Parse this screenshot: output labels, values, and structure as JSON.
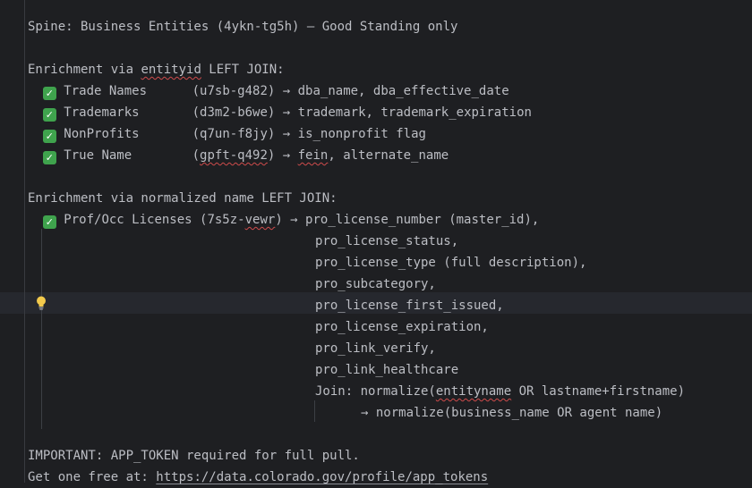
{
  "title_line": "Spine: Business Entities (4ykn-tg5h) — Good Standing only",
  "entityid_section": {
    "prefix": "Enrichment via ",
    "keyword": "entityid",
    "suffix": " LEFT JOIN:",
    "items": [
      {
        "check": "✓",
        "name": "Trade Names",
        "pad": "      ",
        "id_open": "(",
        "id": "u7sb-g482",
        "id_close": ")",
        "arrow": " → ",
        "fields": "dba_name, dba_effective_date"
      },
      {
        "check": "✓",
        "name": "Trademarks",
        "pad": "       ",
        "id_open": "(",
        "id": "d3m2-b6we",
        "id_close": ")",
        "arrow": " → ",
        "fields": "trademark, trademark_expiration"
      },
      {
        "check": "✓",
        "name": "NonProfits",
        "pad": "       ",
        "id_open": "(",
        "id": "q7un-f8jy",
        "id_close": ")",
        "arrow": " → ",
        "fields": "is_nonprofit flag"
      },
      {
        "check": "✓",
        "name": "True Name",
        "pad": "        ",
        "id_open": "(",
        "id": "gpft-q492",
        "id_close": ")",
        "arrow": " → ",
        "fields_squig": "fein",
        "fields": ", alternate_name"
      }
    ]
  },
  "name_section": {
    "header": "Enrichment via normalized name LEFT JOIN:",
    "license": {
      "check": "✓",
      "name": "Prof/Occ Licenses ",
      "id_a": "(7s5z-",
      "id_b": "vewr",
      "id_c": ")",
      "arrow": " → ",
      "first_field": "pro_license_number (master_id),"
    },
    "fields": [
      "pro_license_status,",
      "pro_license_type (full description),",
      "pro_subcategory,",
      "pro_license_first_issued,",
      "pro_license_expiration,",
      "pro_link_verify,",
      "pro_link_healthcare"
    ],
    "join_prefix": "Join: normalize(",
    "join_keyword": "entityname",
    "join_suffix": " OR lastname+firstname)",
    "join_target": "→ normalize(business_name OR agent name)"
  },
  "footer": {
    "important": "IMPORTANT: APP_TOKEN required for full pull.",
    "free_prefix": "Get one free at: ",
    "url": "https://data.colorado.gov/profile/app_tokens"
  },
  "icons": {
    "check": "white-check-mark-emoji",
    "bulb": "lightbulb-intention-icon"
  },
  "colors": {
    "background": "#1e1f22",
    "text": "#bcbec4",
    "check_green": "#3fa34d",
    "squiggle": "#cf4b4b",
    "bulb": "#f2c94c"
  }
}
